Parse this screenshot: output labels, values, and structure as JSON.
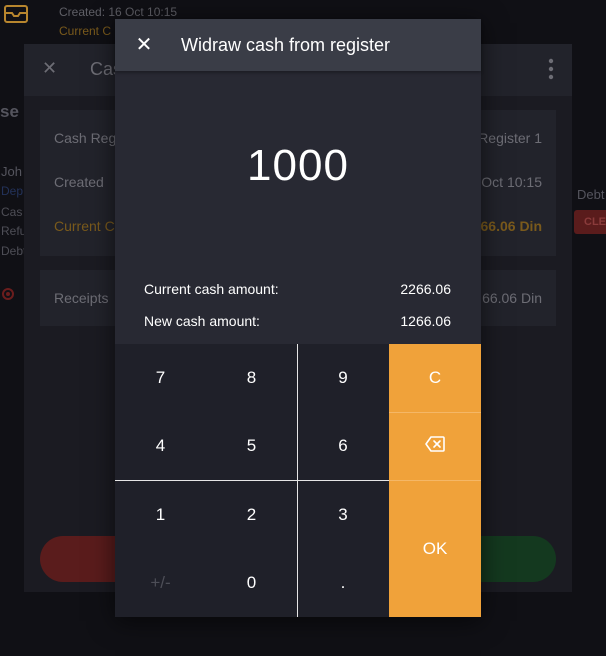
{
  "background": {
    "created_text": "Created: 16 Oct 10:15",
    "current_text": "Current C",
    "dialog_title_partial": "Cas",
    "section_partial": "se",
    "left_texts": [
      "Joh",
      "Dep",
      "Cas",
      "Refu",
      "Debt"
    ],
    "debt_label": "Debt",
    "clear_label": "CLE",
    "rows": [
      {
        "label": "Cash Reg",
        "value": "Register 1"
      },
      {
        "label": "Created",
        "value": "Oct 10:15"
      },
      {
        "label": "Current C",
        "value": "66.06 Din"
      }
    ],
    "receipts": {
      "label": "Receipts",
      "value": "66.06 Din"
    }
  },
  "dialog": {
    "title": "Widraw cash from register",
    "close_symbol": "✕",
    "amount": "1000",
    "current_label": "Current cash amount:",
    "current_value": "2266.06",
    "new_label": "New cash amount:",
    "new_value": "1266.06"
  },
  "keypad": {
    "k7": "7",
    "k8": "8",
    "k9": "9",
    "k4": "4",
    "k5": "5",
    "k6": "6",
    "k1": "1",
    "k2": "2",
    "k3": "3",
    "kpm": "+/-",
    "k0": "0",
    "kdot": ".",
    "clear": "C",
    "ok": "OK"
  },
  "icons": {
    "backspace": "backspace-icon",
    "close": "close-icon",
    "menu": "more-vertical-icon"
  },
  "colors": {
    "accent": "#f0a23a",
    "modal_bg": "#282933",
    "header_bg": "#3a3d47",
    "keypad_bg": "#1f2029"
  }
}
